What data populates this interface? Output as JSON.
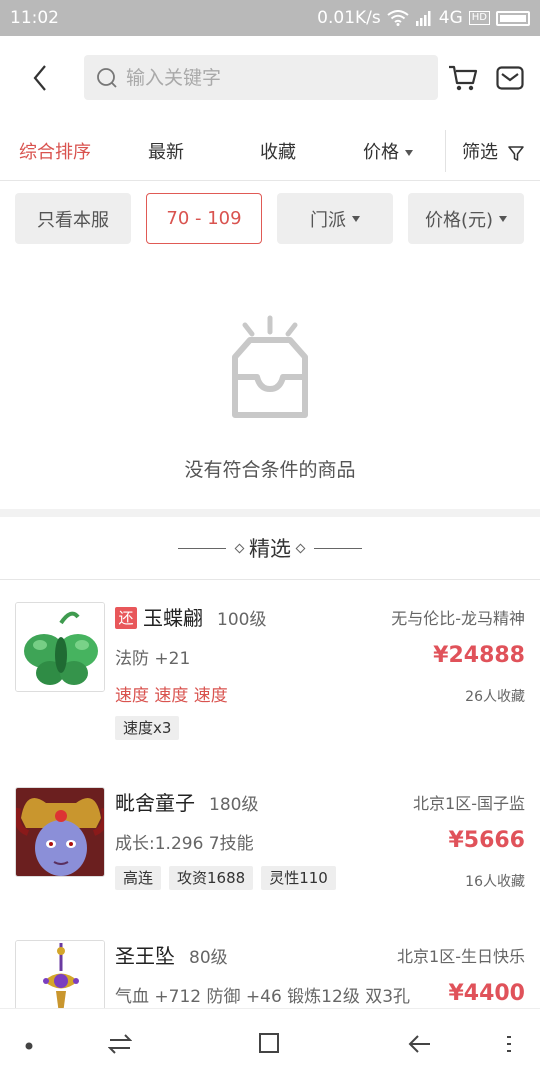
{
  "status_bar": {
    "time": "11:02",
    "speed": "0.01K/s",
    "network": "4G",
    "hd": "HD"
  },
  "search": {
    "placeholder": "输入关键字"
  },
  "sort_tabs": [
    {
      "label": "综合排序",
      "active": true
    },
    {
      "label": "最新"
    },
    {
      "label": "收藏"
    },
    {
      "label": "价格"
    },
    {
      "label": "筛选"
    }
  ],
  "filters": [
    {
      "label": "只看本服"
    },
    {
      "label": "70 - 109",
      "active": true
    },
    {
      "label": "门派"
    },
    {
      "label": "价格(元)"
    }
  ],
  "empty_state": {
    "text": "没有符合条件的商品"
  },
  "section": {
    "title": "精选"
  },
  "items": [
    {
      "badge": "还",
      "name": "玉蝶翩",
      "level": "100级",
      "server": "无与伦比-龙马精神",
      "attr1": "法防 +21",
      "attr2": "速度 速度 速度",
      "price": "¥24888",
      "favs": "26人收藏",
      "tags": [
        "速度x3"
      ]
    },
    {
      "name": "毗舍童子",
      "level": "180级",
      "server": "北京1区-国子监",
      "attr1": "成长:1.296 7技能",
      "price": "¥5666",
      "favs": "16人收藏",
      "tags": [
        "高连",
        "攻资1688",
        "灵性110"
      ]
    },
    {
      "name": "圣王坠",
      "level": "80级",
      "server": "北京1区-生日快乐",
      "attr1": "气血 +712 防御 +46 锻炼12级 双3孔",
      "price": "¥4400"
    }
  ],
  "colors": {
    "accent": "#d9534f",
    "price": "#e0525a",
    "chip_bg": "#eeeeee"
  }
}
